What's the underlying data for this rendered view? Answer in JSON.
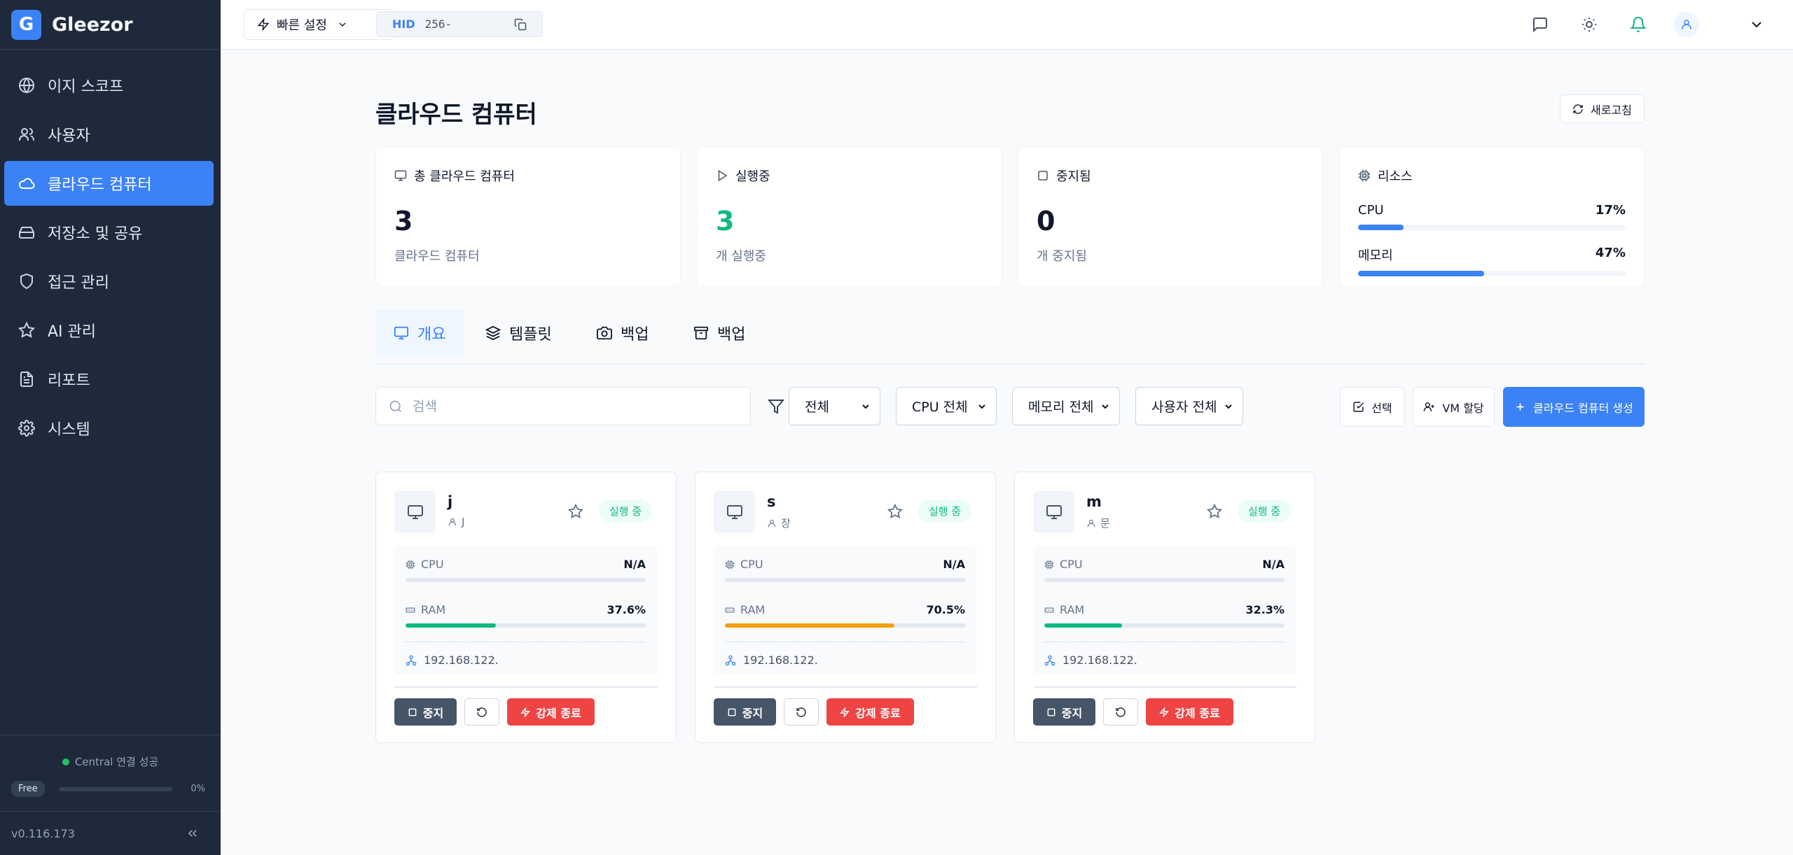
{
  "brand": {
    "logo_letter": "G",
    "name": "Gleezor"
  },
  "sidebar": {
    "items": [
      {
        "label": "이지 스코프",
        "icon": "globe-icon"
      },
      {
        "label": "사용자",
        "icon": "users-icon"
      },
      {
        "label": "클라우드 컴퓨터",
        "icon": "cloud-icon",
        "active": true
      },
      {
        "label": "저장소 및 공유",
        "icon": "hard-drive-icon"
      },
      {
        "label": "접근 관리",
        "icon": "shield-icon"
      },
      {
        "label": "AI 관리",
        "icon": "star-icon"
      },
      {
        "label": "리포트",
        "icon": "file-text-icon"
      },
      {
        "label": "시스템",
        "icon": "gear-icon"
      }
    ],
    "connection_status": "Central 연결 성공",
    "plan_label": "Free",
    "plan_usage_pct": "0%",
    "plan_usage_fraction": 0,
    "version": "v0.116.173"
  },
  "topbar": {
    "quick_settings_label": "빠른 설정",
    "hid_label": "HID",
    "hid_value": "256-"
  },
  "page": {
    "title": "클라우드 컴퓨터",
    "refresh_label": "새로고침"
  },
  "stats": {
    "total": {
      "label": "총 클라우드 컴퓨터",
      "value": "3",
      "sub": "클라우드 컴퓨터"
    },
    "running": {
      "label": "실행중",
      "value": "3",
      "sub": "개 실행중"
    },
    "stopped": {
      "label": "중지됨",
      "value": "0",
      "sub": "개 중지됨"
    },
    "resources": {
      "label": "리소스",
      "cpu_label": "CPU",
      "cpu_pct": "17%",
      "cpu_fraction": 0.17,
      "mem_label": "메모리",
      "mem_pct": "47%",
      "mem_fraction": 0.47
    }
  },
  "tabs": [
    {
      "label": "개요",
      "active": true
    },
    {
      "label": "템플릿"
    },
    {
      "label": "백업"
    },
    {
      "label": "백업"
    }
  ],
  "filters": {
    "search_placeholder": "검색",
    "status_select": "전체",
    "cpu_select": "CPU 전체",
    "memory_select": "메모리 전체",
    "user_select": "사용자 전체",
    "select_btn": "선택",
    "assign_btn": "VM 할당",
    "create_btn": "클라우드 컴퓨터 생성"
  },
  "vms": [
    {
      "name": "j",
      "owner": "J",
      "status": "실행 중",
      "cpu_label": "CPU",
      "cpu": "N/A",
      "ram_label": "RAM",
      "ram": "37.6%",
      "ram_fraction": 0.376,
      "ram_color": "#10b981",
      "ip": "192.168.122."
    },
    {
      "name": "s",
      "owner": "장",
      "status": "실행 중",
      "cpu_label": "CPU",
      "cpu": "N/A",
      "ram_label": "RAM",
      "ram": "70.5%",
      "ram_fraction": 0.705,
      "ram_color": "#f59e0b",
      "ip": "192.168.122."
    },
    {
      "name": "m",
      "owner": "문",
      "status": "실행 중",
      "cpu_label": "CPU",
      "cpu": "N/A",
      "ram_label": "RAM",
      "ram": "32.3%",
      "ram_fraction": 0.323,
      "ram_color": "#10b981",
      "ip": "192.168.122."
    }
  ],
  "vm_actions": {
    "stop": "중지",
    "kill": "강제 종료"
  },
  "colors": {
    "accent": "#3b82f6",
    "sidebar_bg": "#1e293b",
    "success": "#10b981",
    "danger": "#ef4444"
  }
}
